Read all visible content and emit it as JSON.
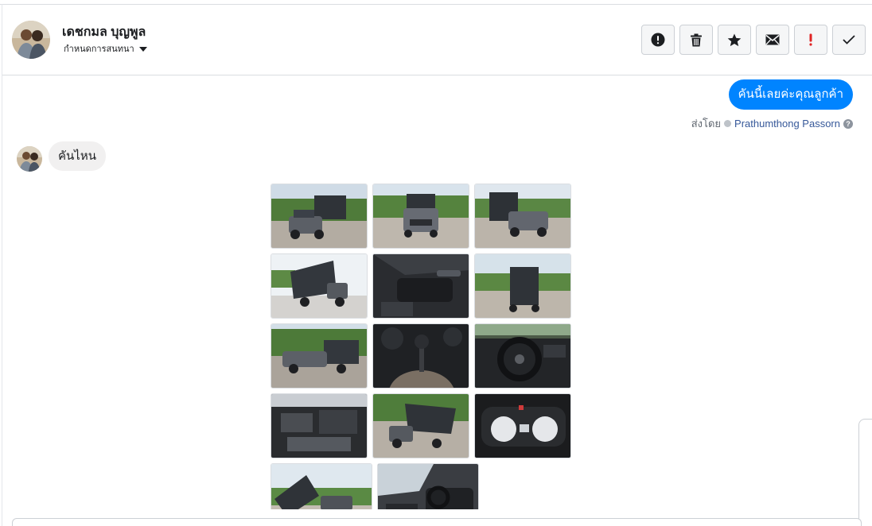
{
  "header": {
    "contact_name": "เดชกมล บุญพูล",
    "assign_label": "กำหนดการสนทนา",
    "actions": [
      {
        "name": "report-button",
        "icon": "alert-circle-icon"
      },
      {
        "name": "delete-button",
        "icon": "trash-icon"
      },
      {
        "name": "star-button",
        "icon": "star-icon"
      },
      {
        "name": "mark-unread-button",
        "icon": "envelope-icon"
      },
      {
        "name": "follow-up-button",
        "icon": "exclamation-icon"
      },
      {
        "name": "mark-done-button",
        "icon": "check-icon"
      }
    ]
  },
  "messages": {
    "outgoing_text": "คันนี้เลยค่ะคุณลูกค้า",
    "sent_by_label": "ส่งโดย",
    "agent_name": "Prathumthong Passorn",
    "incoming_text": "คันไหน"
  },
  "gallery": {
    "image_count": 14,
    "images": [
      {
        "name": "photo-truck-front-left",
        "subject": "dump-truck-exterior"
      },
      {
        "name": "photo-truck-front",
        "subject": "dump-truck-exterior"
      },
      {
        "name": "photo-truck-front-right",
        "subject": "dump-truck-exterior"
      },
      {
        "name": "photo-truck-rear-left",
        "subject": "dump-truck-rear"
      },
      {
        "name": "photo-door-panel",
        "subject": "interior-door"
      },
      {
        "name": "photo-truck-rear",
        "subject": "dump-truck-rear"
      },
      {
        "name": "photo-truck-side",
        "subject": "dump-truck-exterior"
      },
      {
        "name": "photo-gear-shifter",
        "subject": "interior-console"
      },
      {
        "name": "photo-dashboard",
        "subject": "interior-dashboard"
      },
      {
        "name": "photo-engine-bay",
        "subject": "engine"
      },
      {
        "name": "photo-truck-rear-high",
        "subject": "dump-truck-rear"
      },
      {
        "name": "photo-gauge-cluster",
        "subject": "instrument-cluster"
      },
      {
        "name": "photo-dump-bed-raised",
        "subject": "dump-truck-bed"
      },
      {
        "name": "photo-cabin-interior",
        "subject": "interior-cabin"
      }
    ]
  },
  "colors": {
    "outgoing_bubble": "#0084ff",
    "incoming_bubble": "#f1f0f0",
    "follow_up_red": "#e02424",
    "agent_link": "#365899"
  }
}
